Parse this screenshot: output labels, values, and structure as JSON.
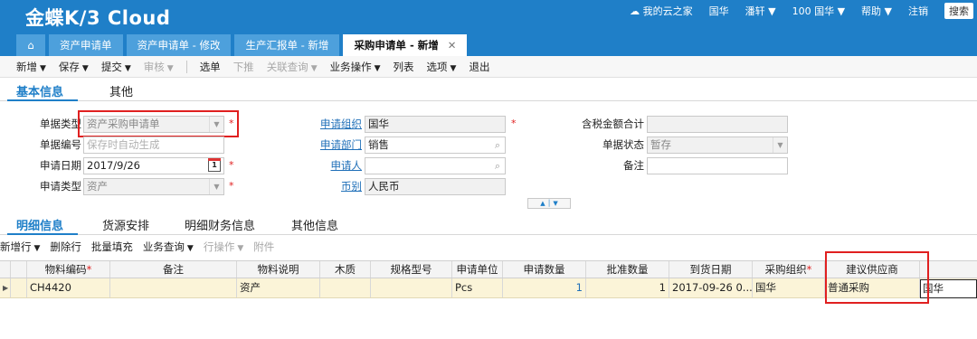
{
  "app": {
    "logo": "金蝶K/3 Cloud",
    "nav": [
      "我的云之家",
      "国华",
      "潘轩 ▼",
      "100 国华 ▼",
      "帮助 ▼",
      "注销"
    ],
    "search": "搜索"
  },
  "tabs": [
    {
      "label": "资产申请单"
    },
    {
      "label": "资产申请单 - 修改"
    },
    {
      "label": "生产汇报单 - 新增"
    },
    {
      "label": "采购申请单 - 新增"
    }
  ],
  "toolbar": {
    "items": [
      "新增",
      "保存",
      "提交",
      "审核",
      "选单",
      "下推",
      "关联查询",
      "业务操作",
      "列表",
      "选项",
      "退出"
    ]
  },
  "section_tabs": {
    "basic": "基本信息",
    "other": "其他"
  },
  "form": {
    "doc_type": {
      "label": "单据类型",
      "value": "资产采购申请单"
    },
    "doc_no": {
      "label": "单据编号",
      "placeholder": "保存时自动生成"
    },
    "apply_date": {
      "label": "申请日期",
      "value": "2017/9/26",
      "cal": "1"
    },
    "apply_type": {
      "label": "申请类型",
      "value": "资产"
    },
    "apply_org": {
      "label": "申请组织",
      "value": "国华"
    },
    "apply_dept": {
      "label": "申请部门",
      "value": "销售"
    },
    "applicant": {
      "label": "申请人",
      "value": ""
    },
    "currency": {
      "label": "币别",
      "value": "人民币"
    },
    "total_tax": {
      "label": "含税金额合计",
      "value": ""
    },
    "doc_status": {
      "label": "单据状态",
      "value": "暂存"
    },
    "remark": {
      "label": "备注",
      "value": ""
    },
    "required_mark": "*"
  },
  "detail_tabs": [
    "明细信息",
    "货源安排",
    "明细财务信息",
    "其他信息"
  ],
  "detail_toolbar": [
    "新增行",
    "删除行",
    "批量填充",
    "业务查询",
    "行操作",
    "附件"
  ],
  "grid": {
    "columns": [
      "物料编码",
      "备注",
      "物料说明",
      "木质",
      "规格型号",
      "申请单位",
      "申请数量",
      "批准数量",
      "到货日期",
      "采购组织",
      "建议供应商"
    ],
    "rows": [
      {
        "material_code": "CH4420",
        "remark": "",
        "material_desc": "资产",
        "wood": "",
        "spec": "",
        "unit": "Pcs",
        "apply_qty": "1",
        "approve_qty": "1",
        "arrival_date": "2017-09-26 0...",
        "purchase_org": "国华",
        "supplier": "普通采购",
        "editing": "国华"
      }
    ]
  }
}
